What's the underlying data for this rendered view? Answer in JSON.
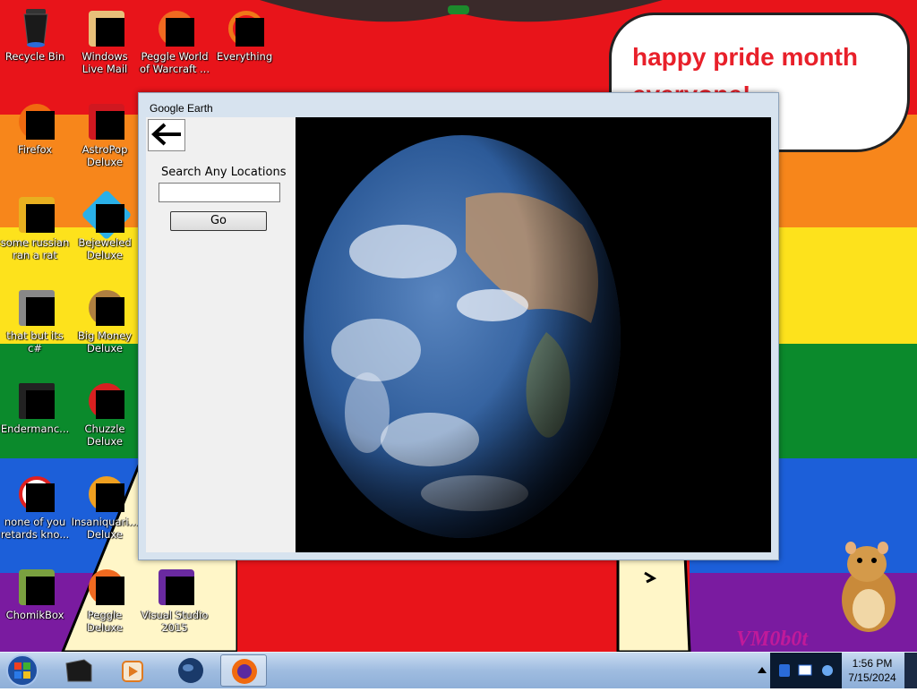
{
  "colors": {
    "stripe_red": "#e8141a",
    "stripe_orange": "#f7861b",
    "stripe_yellow": "#fde21c",
    "stripe_green": "#0b8a2c",
    "stripe_blue": "#1c5fd9",
    "stripe_purple": "#7a1ba0",
    "bubble_text": "#e8202a",
    "window_frame": "#d7e3ef",
    "taskbar": "#9fbce0"
  },
  "desktop": {
    "bubble_line1": "happy pride month",
    "bubble_line2": "everyone!",
    "watermark": "VM0b0t",
    "icons": [
      {
        "label": "Recycle Bin",
        "icon": "recycle-bin-icon"
      },
      {
        "label": "Windows Live Mail",
        "icon": "windows-live-mail-icon"
      },
      {
        "label": "Peggle World of Warcraft ...",
        "icon": "peggle-wow-icon"
      },
      {
        "label": "Everything",
        "icon": "everything-search-icon"
      },
      {
        "label": "Firefox",
        "icon": "firefox-icon"
      },
      {
        "label": "AstroPop Deluxe",
        "icon": "astropop-icon"
      },
      {
        "label": "some russian ran a rat",
        "icon": "adobe-ae-icon"
      },
      {
        "label": "Bejeweled Deluxe",
        "icon": "bejeweled-icon"
      },
      {
        "label": "that but its c#",
        "icon": "windows-stack-icon"
      },
      {
        "label": "Big Money Deluxe",
        "icon": "big-money-icon"
      },
      {
        "label": "Endermanc...",
        "icon": "console-icon"
      },
      {
        "label": "Chuzzle Deluxe",
        "icon": "chuzzle-icon"
      },
      {
        "label": "none of you retards kno...",
        "icon": "red-circle-icon"
      },
      {
        "label": "Insaniquari... Deluxe",
        "icon": "insaniquarium-icon"
      },
      {
        "label": "ChomikBox",
        "icon": "chomikbox-icon"
      },
      {
        "label": "Peggle Deluxe",
        "icon": "peggle-icon"
      },
      {
        "label": "Visual Studio 2015",
        "icon": "visual-studio-icon"
      }
    ]
  },
  "window": {
    "title": "Google Earth",
    "back_icon": "back-arrow-icon",
    "search_label": "Search Any Locations",
    "search_value": "",
    "go_label": "Go"
  },
  "taskbar": {
    "items": [
      {
        "name": "taskbar-terminal",
        "icon": "terminal-icon"
      },
      {
        "name": "taskbar-media-player",
        "icon": "media-player-icon"
      },
      {
        "name": "taskbar-earth",
        "icon": "globe-icon"
      },
      {
        "name": "taskbar-firefox",
        "icon": "firefox-icon",
        "active": true
      }
    ],
    "time": "1:56 PM",
    "date": "7/15/2024"
  }
}
